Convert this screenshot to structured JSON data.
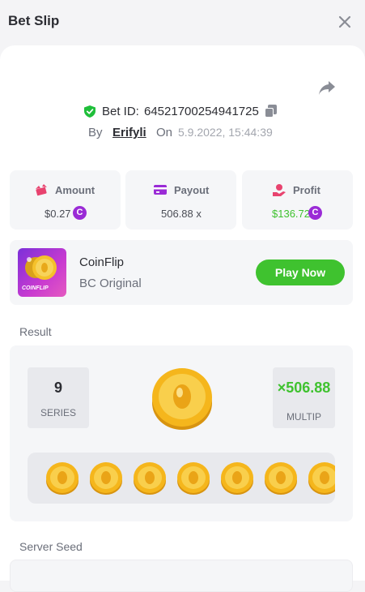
{
  "header": {
    "title": "Bet Slip"
  },
  "bet": {
    "id_label": "Bet ID:",
    "id_value": "64521700254941725",
    "by_label": "By",
    "user": "Erifyli",
    "on_label": "On",
    "date": "5.9.2022, 15:44:39"
  },
  "stats": {
    "amount": {
      "label": "Amount",
      "value": "$0.27",
      "icon": "money-wings-icon"
    },
    "payout": {
      "label": "Payout",
      "value": "506.88 x",
      "icon": "card-icon"
    },
    "profit": {
      "label": "Profit",
      "value": "$136.72",
      "icon": "hand-coin-icon"
    },
    "coin_symbol": "C"
  },
  "game": {
    "name": "CoinFlip",
    "subtitle": "BC Original",
    "thumb_text": "COINFLIP",
    "play_label": "Play Now"
  },
  "result": {
    "label": "Result",
    "series_value": "9",
    "series_label": "SERIES",
    "multiplier_value": "×506.88",
    "multiplier_label": "MULTIP",
    "coins_visible": 7
  },
  "server_seed": {
    "label": "Server Seed"
  },
  "colors": {
    "accent_green": "#3fc22f",
    "coin_purple": "#9a2bd6",
    "shield_green": "#1fbf3a",
    "coin_gold": "#f5b61c"
  }
}
